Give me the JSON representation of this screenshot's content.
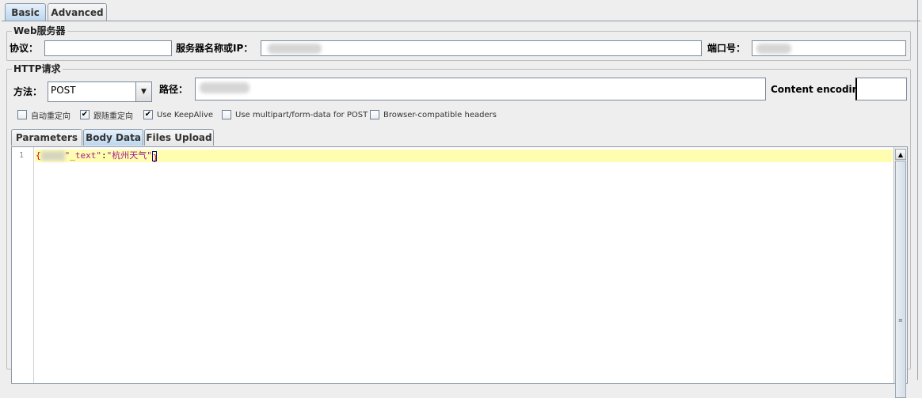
{
  "tabs": {
    "basic": "Basic",
    "advanced": "Advanced"
  },
  "web_server": {
    "title": "Web服务器",
    "protocol_label": "协议：",
    "protocol_value": "",
    "server_label": "服务器名称或IP：",
    "port_label": "端口号："
  },
  "http_request": {
    "title": "HTTP请求",
    "method_label": "方法：",
    "method_value": "POST",
    "path_label": "路径：",
    "encoding_label": "Content encoding:",
    "encoding_value": ""
  },
  "options": [
    {
      "label": "自动重定向",
      "checked": false
    },
    {
      "label": "跟随重定向",
      "checked": true
    },
    {
      "label": "Use KeepAlive",
      "checked": true
    },
    {
      "label": "Use multipart/form-data for POST",
      "checked": false
    },
    {
      "label": "Browser-compatible headers",
      "checked": false
    }
  ],
  "sub_tabs": {
    "parameters": "Parameters",
    "body_data": "Body Data",
    "files_upload": "Files Upload"
  },
  "editor": {
    "line_number": "1",
    "open_brace": "{",
    "key_suffix": "\"_text\"",
    "colon": ":",
    "value": "\"杭州天气\"",
    "close_brace": "}"
  },
  "colors": {
    "current_line": "#fffdb0",
    "selected_tab": "#bcd6ee"
  }
}
